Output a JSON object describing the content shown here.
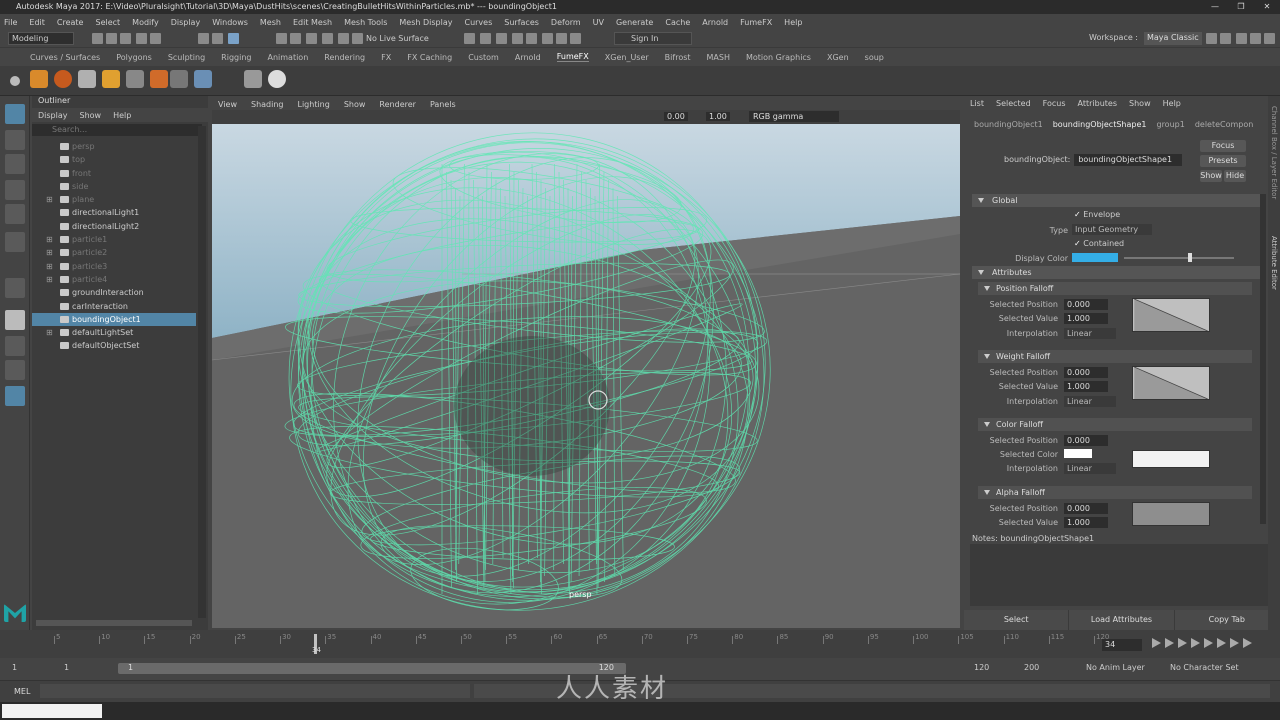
{
  "title": "Autodesk Maya 2017: E:\\Video\\Pluralsight\\Tutorial\\3D\\Maya\\DustHits\\scenes\\CreatingBulletHitsWithinParticles.mb*   ---   boundingObject1",
  "window_controls": [
    "—",
    "❐",
    "✕"
  ],
  "menubar": [
    "File",
    "Edit",
    "Create",
    "Select",
    "Modify",
    "Display",
    "Windows",
    "Mesh",
    "Edit Mesh",
    "Mesh Tools",
    "Mesh Display",
    "Curves",
    "Surfaces",
    "Deform",
    "UV",
    "Generate",
    "Cache",
    "Arnold",
    "FumeFX",
    "Help"
  ],
  "toolbar": {
    "mode": "Modeling",
    "live_surface": "No Live Surface",
    "signin": "Sign In",
    "workspace_label": "Workspace :",
    "workspace_value": "Maya Classic"
  },
  "shelf_tabs": [
    "Curves / Surfaces",
    "Polygons",
    "Sculpting",
    "Rigging",
    "Animation",
    "Rendering",
    "FX",
    "FX Caching",
    "Custom",
    "Arnold",
    "FumeFX",
    "XGen_User",
    "Bifrost",
    "MASH",
    "Motion Graphics",
    "XGen",
    "soup"
  ],
  "shelf_active": "FumeFX",
  "outliner": {
    "title": "Outliner",
    "menu": [
      "Display",
      "Show",
      "Help"
    ],
    "search_placeholder": "Search...",
    "items": [
      {
        "label": "persp",
        "faint": true,
        "indent": 1
      },
      {
        "label": "top",
        "faint": true,
        "indent": 1
      },
      {
        "label": "front",
        "faint": true,
        "indent": 1
      },
      {
        "label": "side",
        "faint": true,
        "indent": 1
      },
      {
        "label": "plane",
        "faint": true,
        "indent": 0,
        "expand": true
      },
      {
        "label": "directionalLight1",
        "faint": false,
        "indent": 1
      },
      {
        "label": "directionalLight2",
        "faint": false,
        "indent": 1
      },
      {
        "label": "particle1",
        "faint": true,
        "indent": 0,
        "expand": true
      },
      {
        "label": "particle2",
        "faint": true,
        "indent": 0,
        "expand": true
      },
      {
        "label": "particle3",
        "faint": true,
        "indent": 0,
        "expand": true
      },
      {
        "label": "particle4",
        "faint": true,
        "indent": 0,
        "expand": true
      },
      {
        "label": "groundInteraction",
        "faint": false,
        "indent": 1
      },
      {
        "label": "carInteraction",
        "faint": false,
        "indent": 1
      },
      {
        "label": "boundingObject1",
        "faint": false,
        "indent": 1,
        "selected": true
      },
      {
        "label": "defaultLightSet",
        "faint": false,
        "indent": 0,
        "expand": true
      },
      {
        "label": "defaultObjectSet",
        "faint": false,
        "indent": 1
      }
    ]
  },
  "viewport": {
    "menu": [
      "View",
      "Shading",
      "Lighting",
      "Show",
      "Renderer",
      "Panels"
    ],
    "value1": "0.00",
    "value2": "1.00",
    "color_space": "RGB gamma",
    "camera": "persp"
  },
  "attribute_editor": {
    "menu": [
      "List",
      "Selected",
      "Focus",
      "Attributes",
      "Show",
      "Help"
    ],
    "tabs": [
      "boundingObject1",
      "boundingObjectShape1",
      "group1",
      "deleteCompon"
    ],
    "active_tab": "boundingObjectShape1",
    "object_label": "boundingObject:",
    "object_value": "boundingObjectShape1",
    "buttons": {
      "focus": "Focus",
      "presets": "Presets",
      "show": "Show",
      "hide": "Hide"
    },
    "global": {
      "title": "Global",
      "envelope": "Envelope",
      "type_label": "Type",
      "type_value": "Input Geometry",
      "contained": "Contained",
      "display_color_label": "Display Color"
    },
    "attributes_title": "Attributes",
    "position_falloff": {
      "title": "Position Falloff",
      "sel_pos_label": "Selected Position",
      "sel_pos": "0.000",
      "sel_val_label": "Selected Value",
      "sel_val": "1.000",
      "interp_label": "Interpolation",
      "interp": "Linear"
    },
    "weight_falloff": {
      "title": "Weight Falloff",
      "sel_pos_label": "Selected Position",
      "sel_pos": "0.000",
      "sel_val_label": "Selected Value",
      "sel_val": "1.000",
      "interp_label": "Interpolation",
      "interp": "Linear"
    },
    "color_falloff": {
      "title": "Color Falloff",
      "sel_pos_label": "Selected Position",
      "sel_pos": "0.000",
      "sel_color_label": "Selected Color",
      "interp_label": "Interpolation",
      "interp": "Linear"
    },
    "alpha_falloff": {
      "title": "Alpha Falloff",
      "sel_pos_label": "Selected Position",
      "sel_pos": "0.000",
      "sel_val_label": "Selected Value",
      "sel_val": "1.000"
    },
    "notes": "Notes:  boundingObjectShape1",
    "bottom_buttons": [
      "Select",
      "Load Attributes",
      "Copy Tab"
    ],
    "side_tabs": "Channel Box / Layer Editor",
    "side_tabs2": "Attribute Editor"
  },
  "timeline": {
    "ticks": [
      "5",
      "10",
      "15",
      "20",
      "25",
      "30",
      "35",
      "40",
      "45",
      "50",
      "55",
      "60",
      "65",
      "70",
      "75",
      "80",
      "85",
      "90",
      "95",
      "100",
      "105",
      "110",
      "115",
      "120"
    ],
    "current_frame": "34",
    "current_frame_marker": "34"
  },
  "range": {
    "start": "1",
    "start2": "1",
    "slider_start": "1",
    "slider_end": "120",
    "end": "120",
    "end2": "200",
    "anim_layer": "No Anim Layer",
    "char_set": "No Character Set"
  },
  "mel_label": "MEL",
  "watermark": "人人素材",
  "colors": {
    "display_color": "#34aee6",
    "wire": "#5ee8b3",
    "sky": "#9fb8c8"
  }
}
